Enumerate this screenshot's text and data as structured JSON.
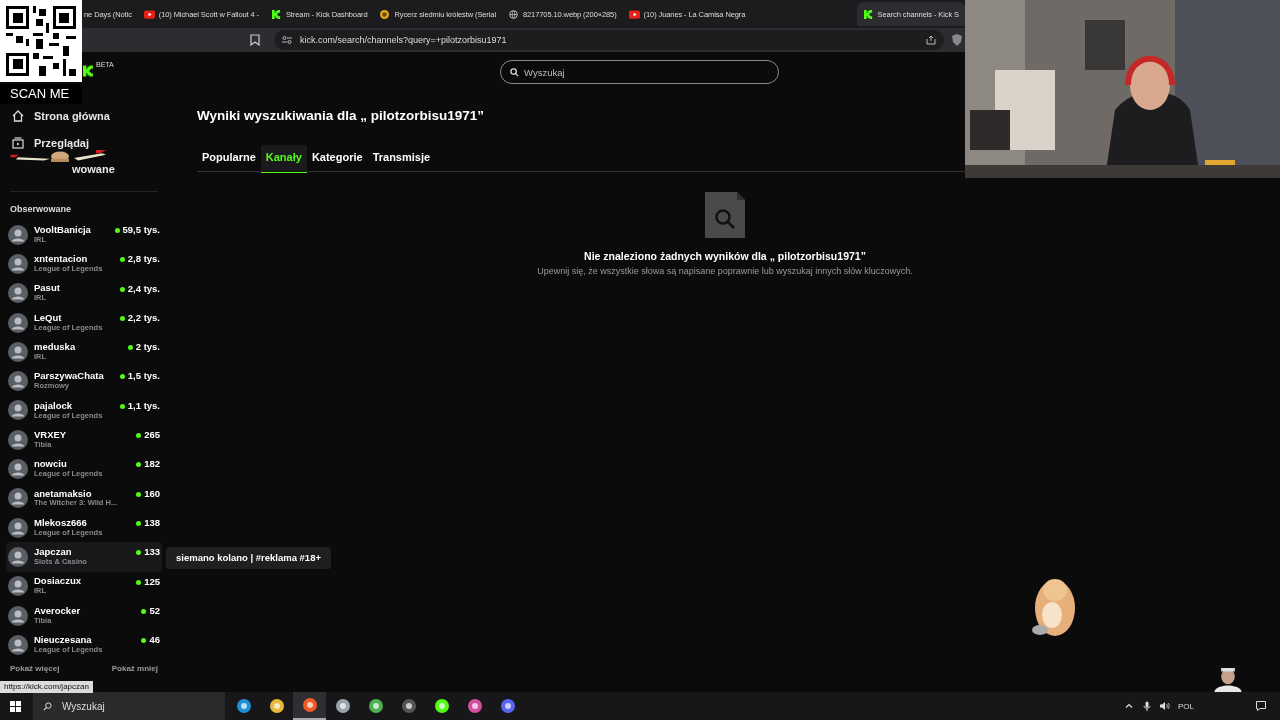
{
  "browser": {
    "tabs": [
      {
        "title": "ne Days (Notic",
        "selected": false
      },
      {
        "title": "(10) Michael Scott w Fallout 4 -",
        "selected": false,
        "kind": "video"
      },
      {
        "title": "Stream - Kick Dashboard",
        "selected": false,
        "kind": "kick"
      },
      {
        "title": "Rycerz siedmiu królestw (Serial",
        "selected": false,
        "kind": "coin"
      },
      {
        "title": "8217705.10.webp (200×285)",
        "selected": false,
        "kind": "globe"
      },
      {
        "title": "(10) Juanes - La Camisa Negra",
        "selected": false,
        "kind": "video"
      },
      {
        "title": "Search channels - Kick S",
        "selected": true,
        "kind": "kick"
      }
    ],
    "url": "kick.com/search/channels?query=+pilotzorbisu1971"
  },
  "overlay": {
    "qr_label": "SCAN ME"
  },
  "logo": {
    "badge": "BETA"
  },
  "nav": [
    {
      "label": "Strona główna",
      "kind": "home"
    },
    {
      "label": "Przeglądaj",
      "kind": "browse"
    },
    {
      "label": "wowane",
      "kind": "following"
    }
  ],
  "following": {
    "title": "Obserwowane",
    "channels": [
      {
        "name": "VooltBanicja",
        "category": "IRL",
        "viewers": "59,5 tys.",
        "hovered": false
      },
      {
        "name": "xntentacion",
        "category": "League of Legends",
        "viewers": "2,8 tys.",
        "hovered": false
      },
      {
        "name": "Pasut",
        "category": "IRL",
        "viewers": "2,4 tys.",
        "hovered": false
      },
      {
        "name": "LeQut",
        "category": "League of Legends",
        "viewers": "2,2 tys.",
        "hovered": false
      },
      {
        "name": "meduska",
        "category": "IRL",
        "viewers": "2 tys.",
        "hovered": false
      },
      {
        "name": "ParszywaChata",
        "category": "Rozmowy",
        "viewers": "1,5 tys.",
        "hovered": false
      },
      {
        "name": "pajalock",
        "category": "League of Legends",
        "viewers": "1,1 tys.",
        "hovered": false
      },
      {
        "name": "VRXEY",
        "category": "Tibia",
        "viewers": "265",
        "hovered": false
      },
      {
        "name": "nowciu",
        "category": "League of Legends",
        "viewers": "182",
        "hovered": false
      },
      {
        "name": "anetamaksio",
        "category": "The Witcher 3: Wild H...",
        "viewers": "160",
        "hovered": false
      },
      {
        "name": "Mlekosz666",
        "category": "League of Legends",
        "viewers": "138",
        "hovered": false
      },
      {
        "name": "Japczan",
        "category": "Slots & Casino",
        "viewers": "133",
        "hovered": true
      },
      {
        "name": "Dosiaczux",
        "category": "IRL",
        "viewers": "125",
        "hovered": false
      },
      {
        "name": "Averocker",
        "category": "Tibia",
        "viewers": "52",
        "hovered": false
      },
      {
        "name": "Nieuczesana",
        "category": "League of Legends",
        "viewers": "46",
        "hovered": false
      }
    ],
    "show_more": "Pokaż więcej",
    "show_less": "Pokaż mniej"
  },
  "search": {
    "placeholder": "Wyszukaj"
  },
  "results": {
    "title": "Wyniki wyszukiwania dla „ pilotzorbisu1971”",
    "tabs": [
      {
        "label": "Popularne",
        "selected": false
      },
      {
        "label": "Kanały",
        "selected": true
      },
      {
        "label": "Kategorie",
        "selected": false
      },
      {
        "label": "Transmisje",
        "selected": false
      }
    ],
    "empty_title": "Nie znaleziono żadnych wyników dla „ pilotzorbisu1971”",
    "empty_hint": "Upewnij się, że wszystkie słowa są napisane poprawnie lub wyszukaj innych słów kluczowych."
  },
  "tooltip": "siemano kolano | #reklama #18+",
  "status_url": "https://kick.com/japczan",
  "taskbar": {
    "search_placeholder": "Wyszukaj",
    "apps": [
      {
        "kind": "edge",
        "selected": false
      },
      {
        "kind": "folder",
        "selected": false
      },
      {
        "kind": "brave",
        "selected": true
      },
      {
        "kind": "app",
        "selected": false
      },
      {
        "kind": "chrome",
        "selected": false
      },
      {
        "kind": "obs",
        "selected": false
      },
      {
        "kind": "kick",
        "selected": false
      },
      {
        "kind": "chat",
        "selected": false
      },
      {
        "kind": "discord",
        "selected": false
      }
    ],
    "language": "POL"
  }
}
